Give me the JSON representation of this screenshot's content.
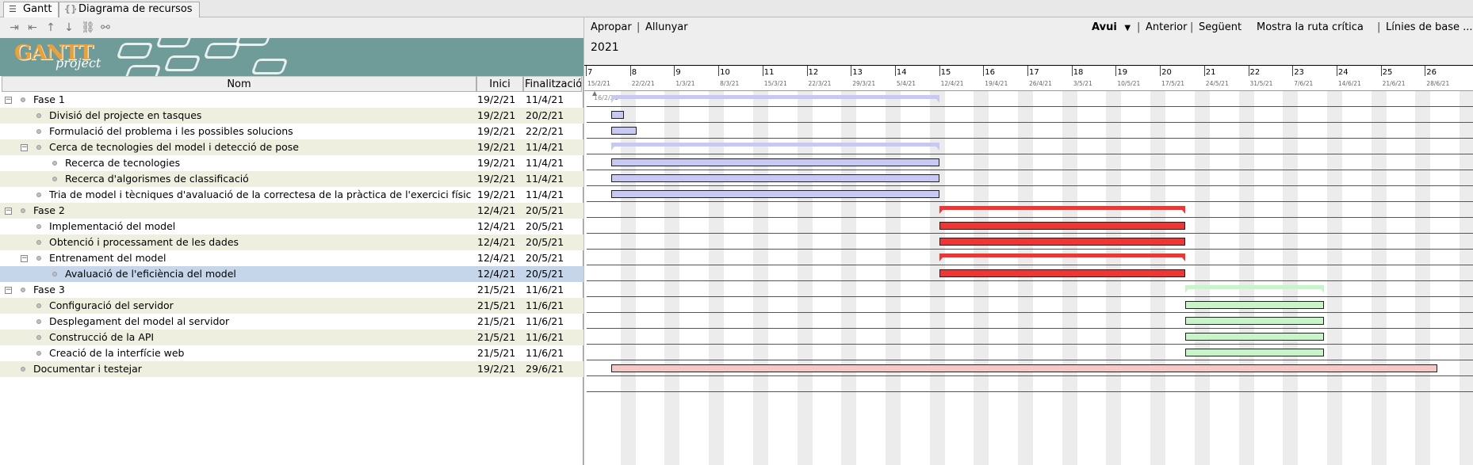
{
  "tabs": [
    {
      "label": "Gantt",
      "icon": "gantt-icon"
    },
    {
      "label": "Diagrama de recursos",
      "icon": "resources-icon"
    }
  ],
  "left_toolbar": {
    "icons": [
      "indent-icon",
      "outdent-icon",
      "move-up-icon",
      "move-down-icon",
      "link-icon",
      "unlink-icon"
    ]
  },
  "banner": {
    "logo": "GANTT",
    "logo_sub": "project"
  },
  "columns": {
    "name": "Nom",
    "start": "Inici",
    "end": "Finalització"
  },
  "tasks": [
    {
      "name": "Fase 1",
      "start": "19/2/21",
      "end": "11/4/21",
      "level": 0,
      "expander": "⊟"
    },
    {
      "name": "Divisió del projecte en tasques",
      "start": "19/2/21",
      "end": "20/2/21",
      "level": 1,
      "expander": ""
    },
    {
      "name": "Formulació del problema i les possibles solucions",
      "start": "19/2/21",
      "end": "22/2/21",
      "level": 1,
      "expander": ""
    },
    {
      "name": "Cerca de tecnologies del model i detecció de pose",
      "start": "19/2/21",
      "end": "11/4/21",
      "level": 1,
      "expander": "⊟"
    },
    {
      "name": "Recerca de tecnologies",
      "start": "19/2/21",
      "end": "11/4/21",
      "level": 2,
      "expander": ""
    },
    {
      "name": "Recerca d'algorismes de classificació",
      "start": "19/2/21",
      "end": "11/4/21",
      "level": 2,
      "expander": ""
    },
    {
      "name": "Tria de model i tècniques d'avaluació de la correctesa de la pràctica de l'exercici físic",
      "start": "19/2/21",
      "end": "11/4/21",
      "level": 1,
      "expander": ""
    },
    {
      "name": "Fase 2",
      "start": "12/4/21",
      "end": "20/5/21",
      "level": 0,
      "expander": "⊟"
    },
    {
      "name": "Implementació del model",
      "start": "12/4/21",
      "end": "20/5/21",
      "level": 1,
      "expander": ""
    },
    {
      "name": "Obtenció i processament de les dades",
      "start": "12/4/21",
      "end": "20/5/21",
      "level": 1,
      "expander": ""
    },
    {
      "name": "Entrenament del model",
      "start": "12/4/21",
      "end": "20/5/21",
      "level": 1,
      "expander": "⊟"
    },
    {
      "name": "Avaluació de l'eficiència del model",
      "start": "12/4/21",
      "end": "20/5/21",
      "level": 2,
      "expander": ""
    },
    {
      "name": "Fase 3",
      "start": "21/5/21",
      "end": "11/6/21",
      "level": 0,
      "expander": "⊟"
    },
    {
      "name": "Configuració del servidor",
      "start": "21/5/21",
      "end": "11/6/21",
      "level": 1,
      "expander": ""
    },
    {
      "name": "Desplegament del model al servidor",
      "start": "21/5/21",
      "end": "11/6/21",
      "level": 1,
      "expander": ""
    },
    {
      "name": "Construcció de la API",
      "start": "21/5/21",
      "end": "11/6/21",
      "level": 1,
      "expander": ""
    },
    {
      "name": "Creació de la interfície web",
      "start": "21/5/21",
      "end": "11/6/21",
      "level": 1,
      "expander": ""
    },
    {
      "name": "Documentar i testejar",
      "start": "19/2/21",
      "end": "29/6/21",
      "level": 0,
      "expander": ""
    }
  ],
  "selected_task": 11,
  "right_toolbar": {
    "zoom_in": "Apropar",
    "zoom_out": "Allunyar",
    "today": "Avui",
    "previous": "Anterior",
    "next": "Següent",
    "critical_path": "Mostra la ruta crítica",
    "baselines": "Línies de base ...",
    "separator": "|"
  },
  "year": "2021",
  "timeline_start": "2021-02-15",
  "timeline_end": "2021-07-05",
  "weeks": [
    {
      "num": "7",
      "date": "15/2/21"
    },
    {
      "num": "8",
      "date": "22/2/21"
    },
    {
      "num": "9",
      "date": "1/3/21"
    },
    {
      "num": "10",
      "date": "8/3/21"
    },
    {
      "num": "11",
      "date": "15/3/21"
    },
    {
      "num": "12",
      "date": "22/3/21"
    },
    {
      "num": "13",
      "date": "29/3/21"
    },
    {
      "num": "14",
      "date": "5/4/21"
    },
    {
      "num": "15",
      "date": "12/4/21"
    },
    {
      "num": "16",
      "date": "19/4/21"
    },
    {
      "num": "17",
      "date": "26/4/21"
    },
    {
      "num": "18",
      "date": "3/5/21"
    },
    {
      "num": "19",
      "date": "10/5/21"
    },
    {
      "num": "20",
      "date": "17/5/21"
    },
    {
      "num": "21",
      "date": "24/5/21"
    },
    {
      "num": "22",
      "date": "31/5/21"
    },
    {
      "num": "23",
      "date": "7/6/21"
    },
    {
      "num": "24",
      "date": "14/6/21"
    },
    {
      "num": "25",
      "date": "21/6/21"
    },
    {
      "num": "26",
      "date": "28/6/21"
    }
  ],
  "today_marker": "16/2/21",
  "bars": [
    {
      "row": 0,
      "start": "2021-02-19",
      "end": "2021-04-11",
      "type": "summary",
      "color": "#c8c8f5"
    },
    {
      "row": 1,
      "start": "2021-02-19",
      "end": "2021-02-20",
      "type": "task",
      "color": "#c8c8f5"
    },
    {
      "row": 2,
      "start": "2021-02-19",
      "end": "2021-02-22",
      "type": "task",
      "color": "#c8c8f5"
    },
    {
      "row": 3,
      "start": "2021-02-19",
      "end": "2021-04-11",
      "type": "summary",
      "color": "#c8c8f5"
    },
    {
      "row": 4,
      "start": "2021-02-19",
      "end": "2021-04-11",
      "type": "task",
      "color": "#c8c8f5"
    },
    {
      "row": 5,
      "start": "2021-02-19",
      "end": "2021-04-11",
      "type": "task",
      "color": "#c8c8f5"
    },
    {
      "row": 6,
      "start": "2021-02-19",
      "end": "2021-04-11",
      "type": "task",
      "color": "#c8c8f5"
    },
    {
      "row": 7,
      "start": "2021-04-12",
      "end": "2021-05-20",
      "type": "summary",
      "color": "#f03535"
    },
    {
      "row": 8,
      "start": "2021-04-12",
      "end": "2021-05-20",
      "type": "task",
      "color": "#f03535"
    },
    {
      "row": 9,
      "start": "2021-04-12",
      "end": "2021-05-20",
      "type": "task",
      "color": "#f03535"
    },
    {
      "row": 10,
      "start": "2021-04-12",
      "end": "2021-05-20",
      "type": "summary",
      "color": "#f03535"
    },
    {
      "row": 11,
      "start": "2021-04-12",
      "end": "2021-05-20",
      "type": "task",
      "color": "#f03535"
    },
    {
      "row": 12,
      "start": "2021-05-21",
      "end": "2021-06-11",
      "type": "summary",
      "color": "#c8f5c8"
    },
    {
      "row": 13,
      "start": "2021-05-21",
      "end": "2021-06-11",
      "type": "task",
      "color": "#c8f5c8"
    },
    {
      "row": 14,
      "start": "2021-05-21",
      "end": "2021-06-11",
      "type": "task",
      "color": "#c8f5c8"
    },
    {
      "row": 15,
      "start": "2021-05-21",
      "end": "2021-06-11",
      "type": "task",
      "color": "#c8f5c8"
    },
    {
      "row": 16,
      "start": "2021-05-21",
      "end": "2021-06-11",
      "type": "task",
      "color": "#c8f5c8"
    },
    {
      "row": 17,
      "start": "2021-02-19",
      "end": "2021-06-29",
      "type": "task",
      "color": "#f5c8c8"
    }
  ]
}
